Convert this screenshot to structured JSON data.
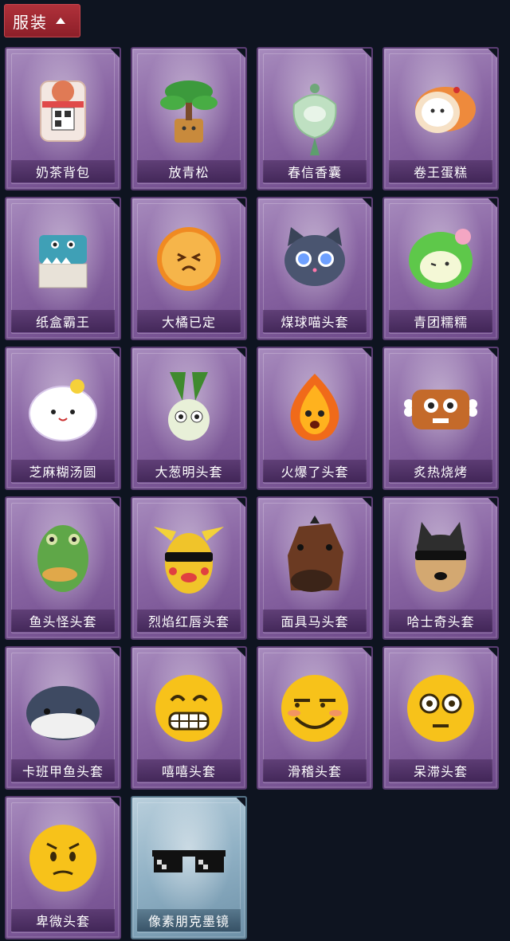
{
  "header": {
    "label": "服装",
    "icon": "chevron-up-icon"
  },
  "items": [
    {
      "name": "奶茶背包",
      "icon": "milk-tea-backpack-icon",
      "rarity": "purple"
    },
    {
      "name": "放青松",
      "icon": "bonsai-pine-icon",
      "rarity": "purple"
    },
    {
      "name": "春信香囊",
      "icon": "sachet-icon",
      "rarity": "purple"
    },
    {
      "name": "卷王蛋糕",
      "icon": "roll-cake-icon",
      "rarity": "purple"
    },
    {
      "name": "纸盒霸王",
      "icon": "cardboard-dino-icon",
      "rarity": "purple"
    },
    {
      "name": "大橘已定",
      "icon": "orange-slice-icon",
      "rarity": "purple"
    },
    {
      "name": "煤球喵头套",
      "icon": "black-cat-head-icon",
      "rarity": "purple"
    },
    {
      "name": "青团糯糯",
      "icon": "green-dumpling-icon",
      "rarity": "purple"
    },
    {
      "name": "芝麻糊汤圆",
      "icon": "rice-ball-icon",
      "rarity": "purple"
    },
    {
      "name": "大葱明头套",
      "icon": "green-onion-head-icon",
      "rarity": "purple"
    },
    {
      "name": "火爆了头套",
      "icon": "fire-head-icon",
      "rarity": "purple"
    },
    {
      "name": "炙热烧烤",
      "icon": "bbq-meat-icon",
      "rarity": "purple"
    },
    {
      "name": "鱼头怪头套",
      "icon": "fish-mask-icon",
      "rarity": "purple"
    },
    {
      "name": "烈焰红唇头套",
      "icon": "yellow-mouse-mask-icon",
      "rarity": "purple"
    },
    {
      "name": "面具马头套",
      "icon": "horse-mask-icon",
      "rarity": "purple"
    },
    {
      "name": "哈士奇头套",
      "icon": "husky-mask-icon",
      "rarity": "purple"
    },
    {
      "name": "卡班甲鱼头套",
      "icon": "whale-head-icon",
      "rarity": "purple"
    },
    {
      "name": "嘻嘻头套",
      "icon": "grin-emoji-icon",
      "rarity": "purple"
    },
    {
      "name": "滑稽头套",
      "icon": "smirk-emoji-icon",
      "rarity": "purple"
    },
    {
      "name": "呆滞头套",
      "icon": "stare-emoji-icon",
      "rarity": "purple"
    },
    {
      "name": "卑微头套",
      "icon": "humble-emoji-icon",
      "rarity": "purple"
    },
    {
      "name": "像素朋克墨镜",
      "icon": "pixel-sunglasses-icon",
      "rarity": "silver"
    }
  ]
}
